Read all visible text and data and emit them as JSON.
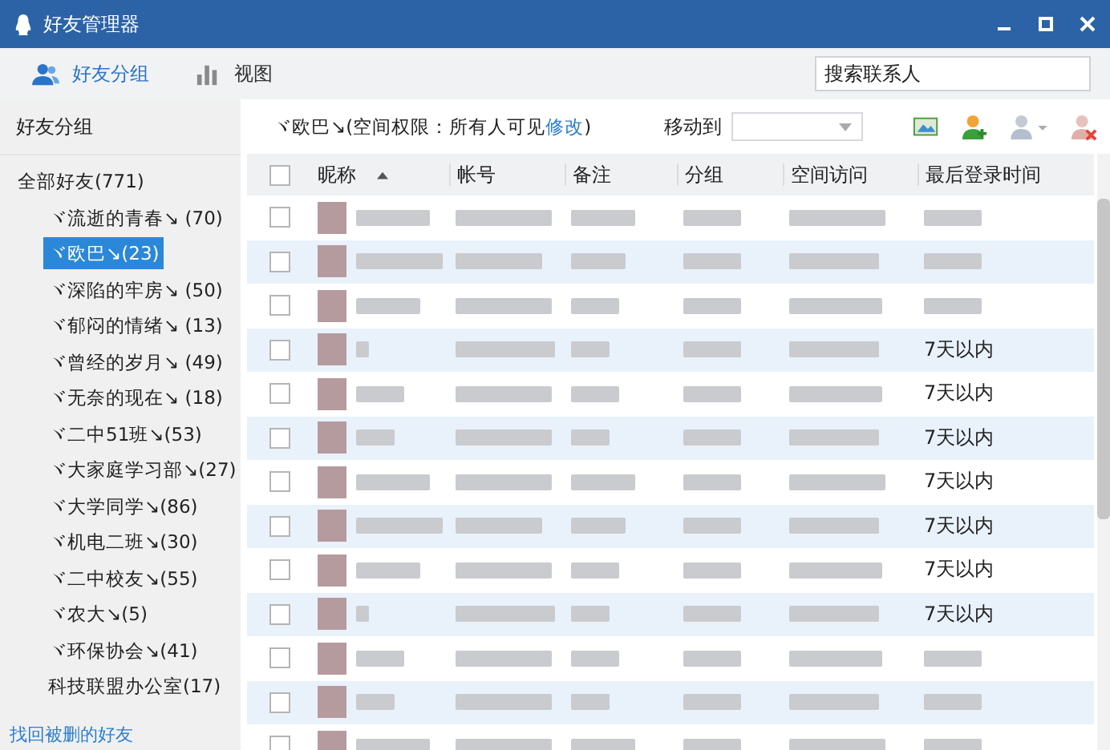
{
  "window": {
    "title": "好友管理器"
  },
  "tabs": [
    {
      "label": "好友分组",
      "kind": "groups",
      "selected": true
    },
    {
      "label": "视图",
      "kind": "view",
      "selected": false
    }
  ],
  "search": {
    "placeholder": "搜索联系人"
  },
  "sidebar": {
    "title": "好友分组",
    "tree": {
      "label": "全部好友(771)",
      "selected": false,
      "children": [
        {
          "label": "ヾ流逝的青春↘ (70)",
          "selected": false
        },
        {
          "label": "ヾ欧巴↘(23)",
          "selected": true
        },
        {
          "label": "ヾ深陷的牢房↘ (50)",
          "selected": false
        },
        {
          "label": "ヾ郁闷的情绪↘ (13)",
          "selected": false
        },
        {
          "label": "ヾ曾经的岁月↘ (49)",
          "selected": false
        },
        {
          "label": "ヾ无奈的现在↘ (18)",
          "selected": false
        },
        {
          "label": "ヾ二中51班↘(53)",
          "selected": false
        },
        {
          "label": "ヾ大家庭学习部↘(27)",
          "selected": false
        },
        {
          "label": "ヾ大学同学↘(86)",
          "selected": false
        },
        {
          "label": "ヾ机电二班↘(30)",
          "selected": false
        },
        {
          "label": "ヾ二中校友↘(55)",
          "selected": false
        },
        {
          "label": "ヾ农大↘(5)",
          "selected": false
        },
        {
          "label": "ヾ环保协会↘(41)",
          "selected": false
        },
        {
          "label": "科技联盟办公室(17)",
          "selected": false
        }
      ]
    },
    "recover_link": "找回被删的好友"
  },
  "breadcrumb": {
    "text": "ヾ欧巴↘(空间权限：所有人可见",
    "link": "修改",
    "close": ")"
  },
  "move_to": {
    "label": "移动到"
  },
  "table": {
    "select_all_checked": false,
    "columns": [
      "昵称",
      "帐号",
      "备注",
      "分组",
      "空间访问",
      "最后登录时间"
    ],
    "rows": [
      {
        "checked": false,
        "last_login": ""
      },
      {
        "checked": false,
        "last_login": ""
      },
      {
        "checked": false,
        "last_login": ""
      },
      {
        "checked": false,
        "last_login": "7天以内"
      },
      {
        "checked": false,
        "last_login": "7天以内"
      },
      {
        "checked": false,
        "last_login": "7天以内"
      },
      {
        "checked": false,
        "last_login": "7天以内"
      },
      {
        "checked": false,
        "last_login": "7天以内"
      },
      {
        "checked": false,
        "last_login": "7天以内"
      },
      {
        "checked": false,
        "last_login": "7天以内"
      },
      {
        "checked": false,
        "last_login": ""
      },
      {
        "checked": false,
        "last_login": ""
      },
      {
        "checked": false,
        "last_login": ""
      }
    ]
  }
}
